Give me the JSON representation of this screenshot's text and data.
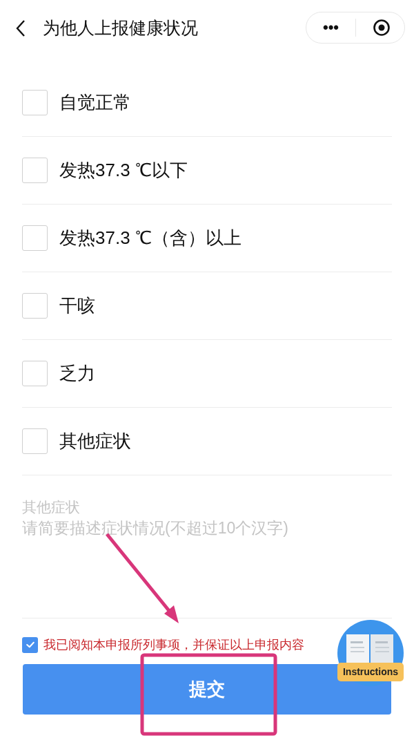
{
  "nav": {
    "title": "为他人上报健康状况",
    "more": "•••"
  },
  "symptoms": [
    {
      "label": "自觉正常",
      "checked": false
    },
    {
      "label": "发热37.3 ℃以下",
      "checked": false
    },
    {
      "label": "发热37.3 ℃（含）以上",
      "checked": false
    },
    {
      "label": "干咳",
      "checked": false
    },
    {
      "label": "乏力",
      "checked": false
    },
    {
      "label": "其他症状",
      "checked": false
    }
  ],
  "other": {
    "label": "其他症状",
    "placeholder": "请简要描述症状情况(不超过10个汉字)"
  },
  "agreement": {
    "text": "我已阅知本申报所列事项，并保证以上申报内容",
    "checked": true
  },
  "submit": "提交",
  "instructions": "Instructions"
}
